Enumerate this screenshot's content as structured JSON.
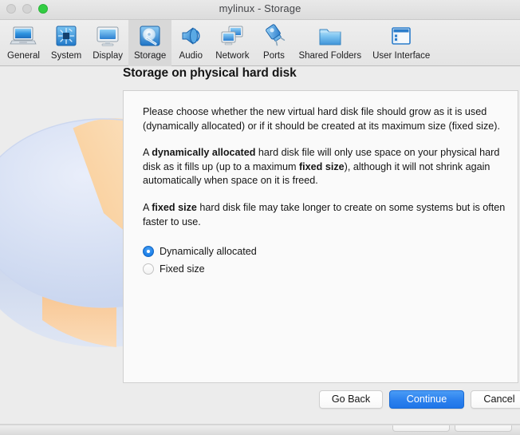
{
  "window": {
    "title": "mylinux - Storage",
    "traffic_lights": [
      {
        "name": "close",
        "color": "#d4d4d4"
      },
      {
        "name": "minimize",
        "color": "#d4d4d4"
      },
      {
        "name": "zoom",
        "color": "#32cd42"
      }
    ]
  },
  "toolbar": {
    "items": [
      {
        "label": "General",
        "icon": "laptop-icon",
        "selected": false
      },
      {
        "label": "System",
        "icon": "motherboard-icon",
        "selected": false
      },
      {
        "label": "Display",
        "icon": "monitor-icon",
        "selected": false
      },
      {
        "label": "Storage",
        "icon": "harddisk-icon",
        "selected": true
      },
      {
        "label": "Audio",
        "icon": "speaker-icon",
        "selected": false
      },
      {
        "label": "Network",
        "icon": "network-icon",
        "selected": false
      },
      {
        "label": "Ports",
        "icon": "plug-icon",
        "selected": false
      },
      {
        "label": "Shared Folders",
        "icon": "folder-icon",
        "selected": false
      },
      {
        "label": "User Interface",
        "icon": "window-icon",
        "selected": false
      }
    ]
  },
  "page": {
    "title": "Storage on physical hard disk",
    "paragraphs": [
      {
        "parts": [
          {
            "text": "Please choose whether the new virtual hard disk file should grow as it is used (dynamically allocated) or if it should be created at its maximum size (fixed size).",
            "bold": false
          }
        ]
      },
      {
        "parts": [
          {
            "text": "A ",
            "bold": false
          },
          {
            "text": "dynamically allocated",
            "bold": true
          },
          {
            "text": " hard disk file will only use space on your physical hard disk as it fills up (up to a maximum ",
            "bold": false
          },
          {
            "text": "fixed size",
            "bold": true
          },
          {
            "text": "), although it will not shrink again automatically when space on it is freed.",
            "bold": false
          }
        ]
      },
      {
        "parts": [
          {
            "text": "A ",
            "bold": false
          },
          {
            "text": "fixed size",
            "bold": true
          },
          {
            "text": " hard disk file may take longer to create on some systems but is often faster to use.",
            "bold": false
          }
        ]
      }
    ],
    "storage_type_options": [
      {
        "label": "Dynamically allocated",
        "selected": true
      },
      {
        "label": "Fixed size",
        "selected": false
      }
    ]
  },
  "footer": {
    "buttons": [
      {
        "id": "btn-goback",
        "label": "Go Back",
        "style": "plain"
      },
      {
        "id": "btn-continue",
        "label": "Continue",
        "style": "primary"
      },
      {
        "id": "btn-cancel",
        "label": "Cancel",
        "style": "plain"
      }
    ]
  },
  "colors": {
    "accent": "#2d82ee",
    "window_chrome": "#ececec",
    "panel": "#fafafa",
    "selected_toolbar": "#d8d8d8",
    "pie_slice": "#f6c38a",
    "pie_body": "#ccd7ef"
  }
}
